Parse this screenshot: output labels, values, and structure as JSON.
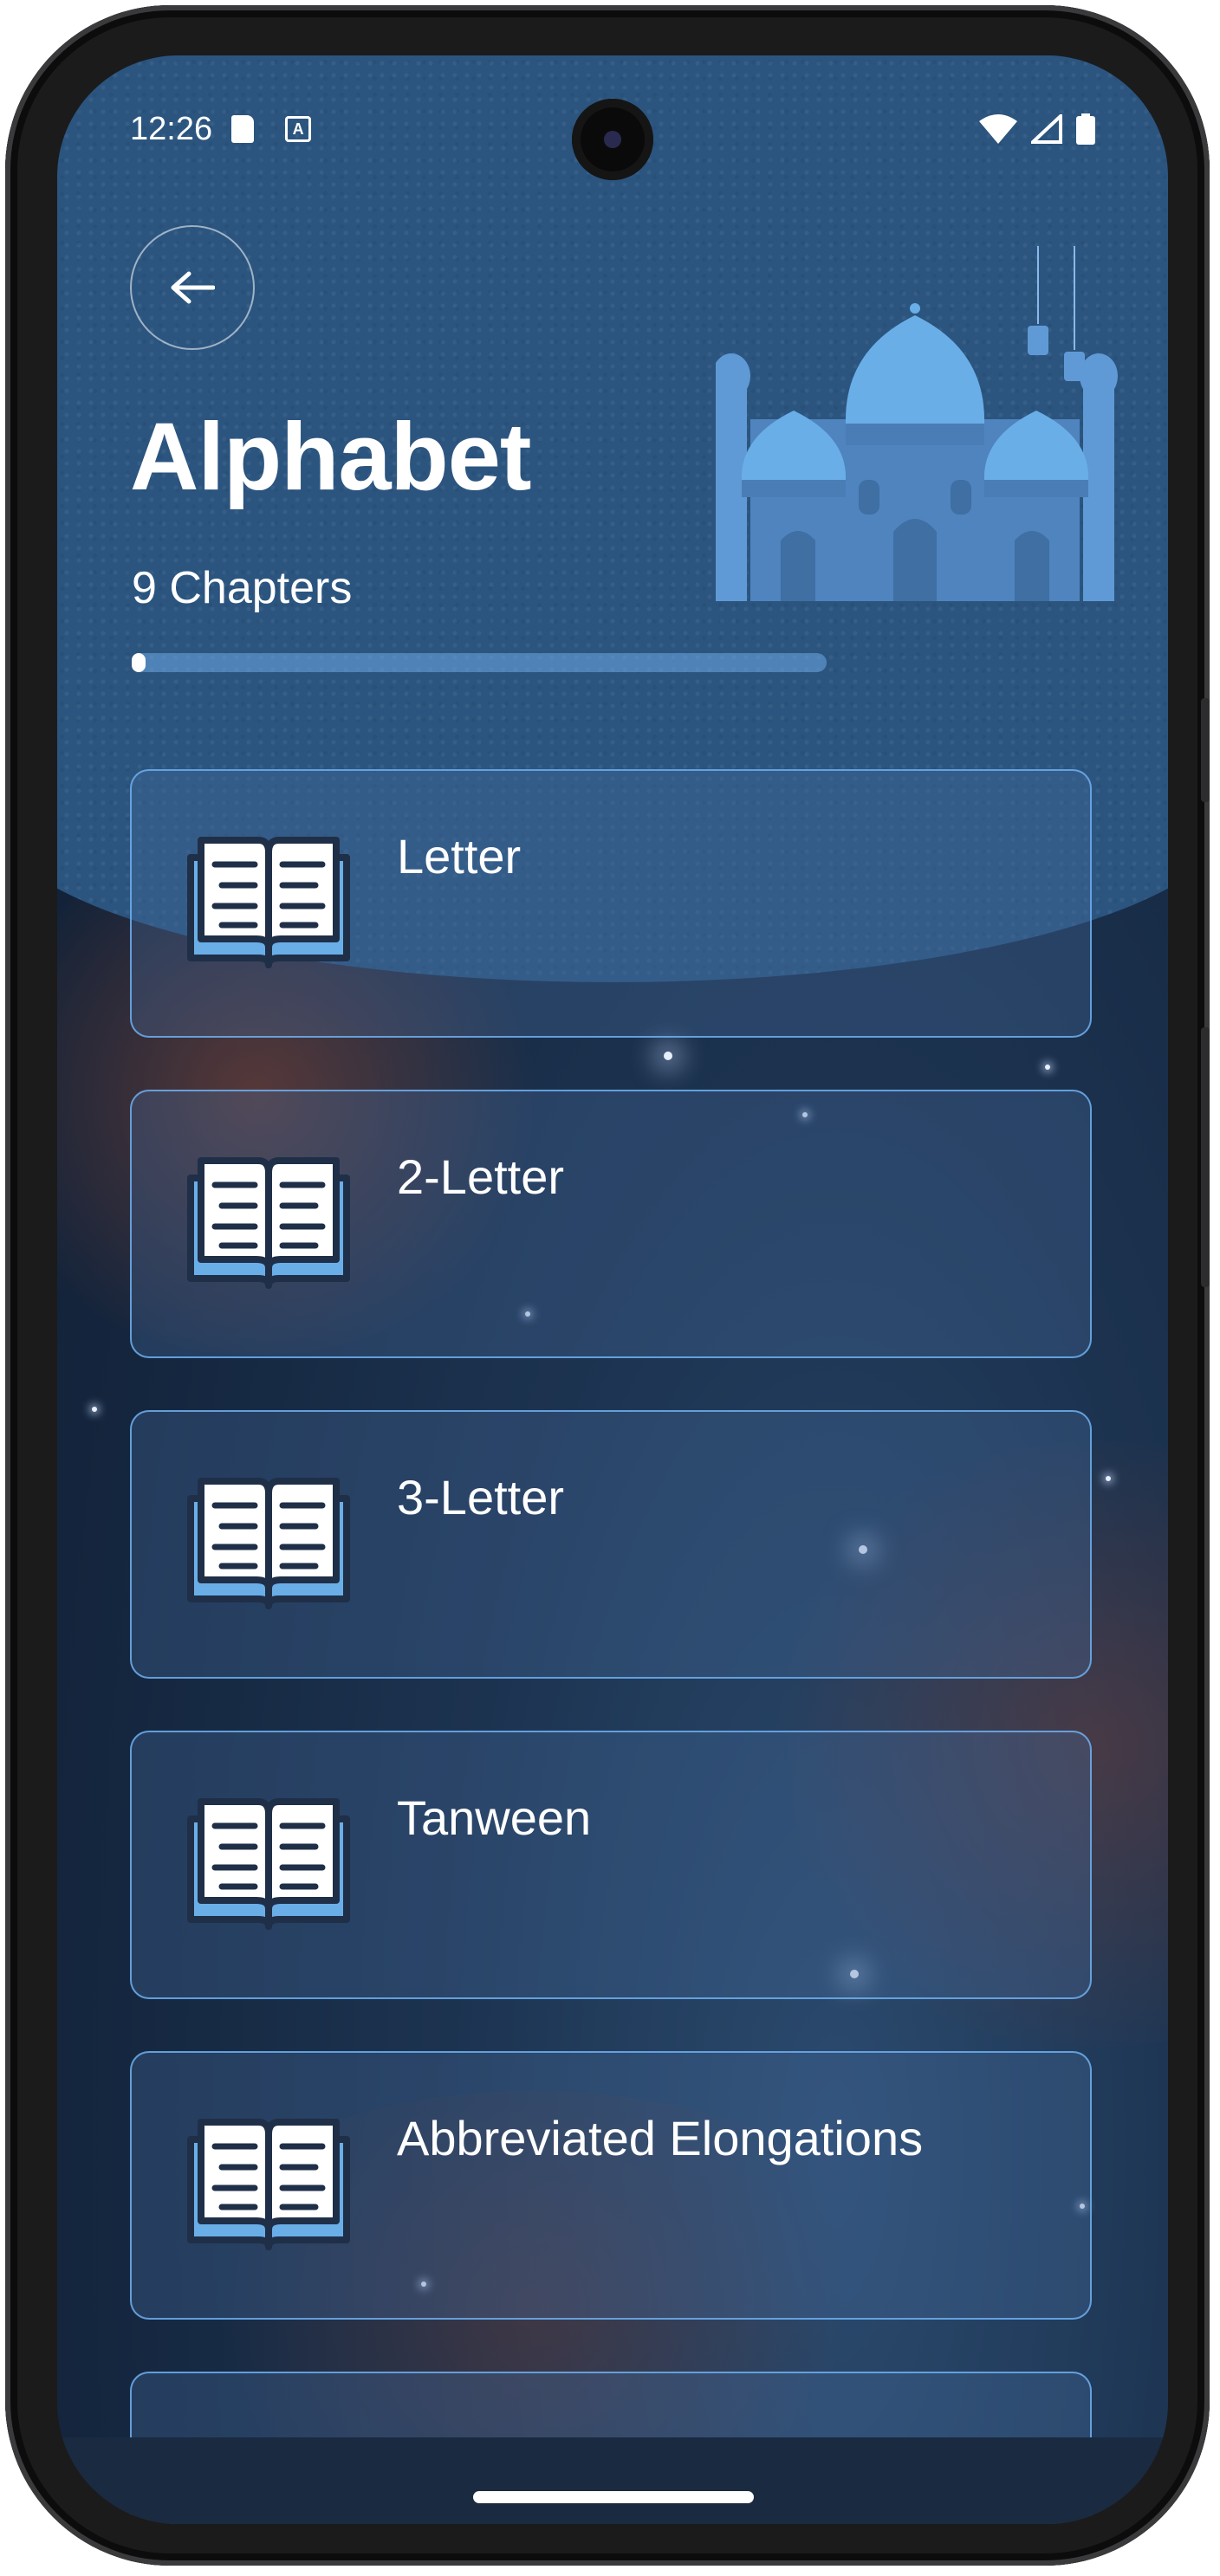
{
  "status_bar": {
    "time": "12:26"
  },
  "header": {
    "title": "Alphabet",
    "subtitle": "9 Chapters",
    "progress_fraction": 0.02
  },
  "chapters": [
    {
      "label": "Letter"
    },
    {
      "label": "2-Letter"
    },
    {
      "label": "3-Letter"
    },
    {
      "label": "Tanween"
    },
    {
      "label": "Abbreviated Elongations"
    },
    {
      "label": ""
    }
  ],
  "colors": {
    "accent": "#6aaee8",
    "card_border": "#6eaff0",
    "header_bg": "#2b557f",
    "background": "#14253d"
  },
  "icons": {
    "back": "arrow-left-icon",
    "chapter": "open-book-icon",
    "illustration": "mosque-illustration"
  }
}
